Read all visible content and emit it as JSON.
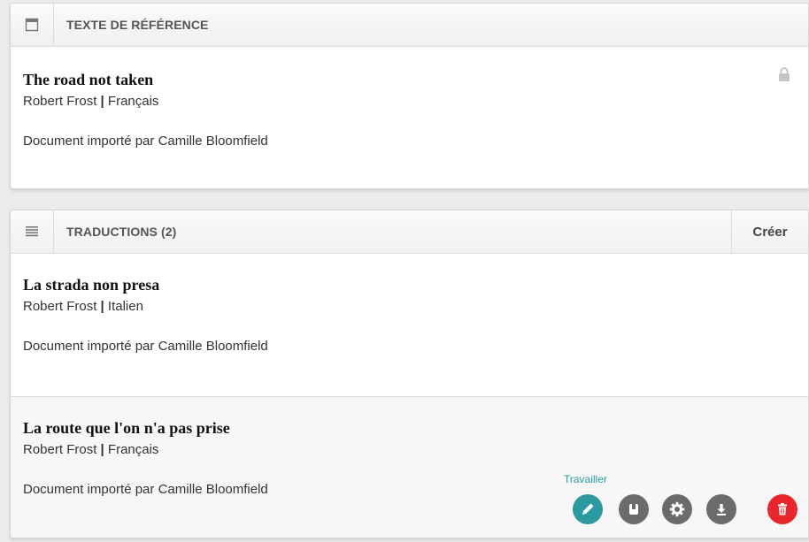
{
  "reference_panel": {
    "title": "TEXTE DE RÉFÉRENCE",
    "doc": {
      "title": "The road not taken",
      "author": "Robert Frost",
      "separator": "|",
      "language": "Français",
      "import_text": "Document importé par Camille Bloomfield"
    }
  },
  "translations_panel": {
    "title": "TRADUCTIONS (2)",
    "create_label": "Créer",
    "items": [
      {
        "title": "La strada non presa",
        "author": "Robert Frost",
        "separator": "|",
        "language": "Italien",
        "import_text": "Document importé par Camille Bloomfield"
      },
      {
        "title": "La route que l'on n'a pas prise",
        "author": "Robert Frost",
        "separator": "|",
        "language": "Français",
        "import_text": "Document importé par Camille Bloomfield",
        "hover_action_label": "Travailler"
      }
    ]
  },
  "colors": {
    "work": "#2a9aa0",
    "neutral_action": "#6b6b6b",
    "delete": "#e8262c"
  }
}
